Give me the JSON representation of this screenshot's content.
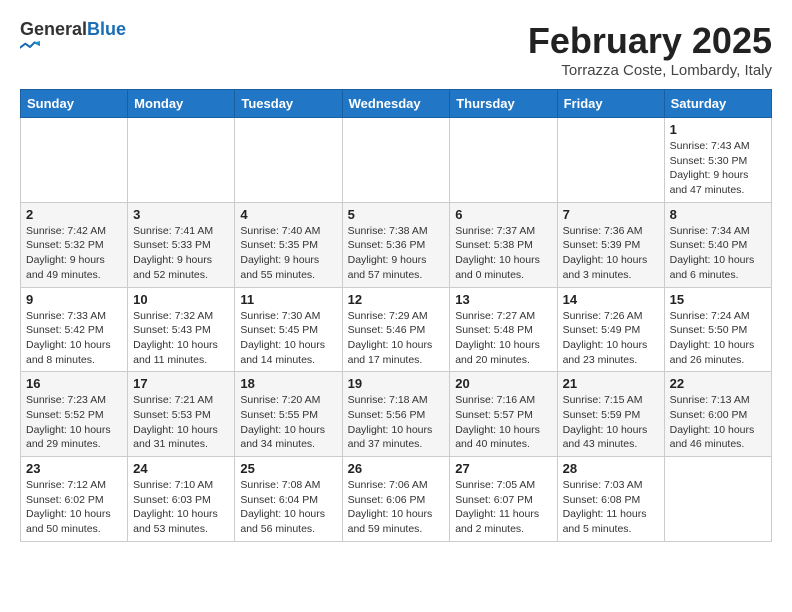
{
  "header": {
    "logo_general": "General",
    "logo_blue": "Blue",
    "month": "February 2025",
    "location": "Torrazza Coste, Lombardy, Italy"
  },
  "days_of_week": [
    "Sunday",
    "Monday",
    "Tuesday",
    "Wednesday",
    "Thursday",
    "Friday",
    "Saturday"
  ],
  "weeks": [
    [
      {
        "day": "",
        "info": ""
      },
      {
        "day": "",
        "info": ""
      },
      {
        "day": "",
        "info": ""
      },
      {
        "day": "",
        "info": ""
      },
      {
        "day": "",
        "info": ""
      },
      {
        "day": "",
        "info": ""
      },
      {
        "day": "1",
        "info": "Sunrise: 7:43 AM\nSunset: 5:30 PM\nDaylight: 9 hours and 47 minutes."
      }
    ],
    [
      {
        "day": "2",
        "info": "Sunrise: 7:42 AM\nSunset: 5:32 PM\nDaylight: 9 hours and 49 minutes."
      },
      {
        "day": "3",
        "info": "Sunrise: 7:41 AM\nSunset: 5:33 PM\nDaylight: 9 hours and 52 minutes."
      },
      {
        "day": "4",
        "info": "Sunrise: 7:40 AM\nSunset: 5:35 PM\nDaylight: 9 hours and 55 minutes."
      },
      {
        "day": "5",
        "info": "Sunrise: 7:38 AM\nSunset: 5:36 PM\nDaylight: 9 hours and 57 minutes."
      },
      {
        "day": "6",
        "info": "Sunrise: 7:37 AM\nSunset: 5:38 PM\nDaylight: 10 hours and 0 minutes."
      },
      {
        "day": "7",
        "info": "Sunrise: 7:36 AM\nSunset: 5:39 PM\nDaylight: 10 hours and 3 minutes."
      },
      {
        "day": "8",
        "info": "Sunrise: 7:34 AM\nSunset: 5:40 PM\nDaylight: 10 hours and 6 minutes."
      }
    ],
    [
      {
        "day": "9",
        "info": "Sunrise: 7:33 AM\nSunset: 5:42 PM\nDaylight: 10 hours and 8 minutes."
      },
      {
        "day": "10",
        "info": "Sunrise: 7:32 AM\nSunset: 5:43 PM\nDaylight: 10 hours and 11 minutes."
      },
      {
        "day": "11",
        "info": "Sunrise: 7:30 AM\nSunset: 5:45 PM\nDaylight: 10 hours and 14 minutes."
      },
      {
        "day": "12",
        "info": "Sunrise: 7:29 AM\nSunset: 5:46 PM\nDaylight: 10 hours and 17 minutes."
      },
      {
        "day": "13",
        "info": "Sunrise: 7:27 AM\nSunset: 5:48 PM\nDaylight: 10 hours and 20 minutes."
      },
      {
        "day": "14",
        "info": "Sunrise: 7:26 AM\nSunset: 5:49 PM\nDaylight: 10 hours and 23 minutes."
      },
      {
        "day": "15",
        "info": "Sunrise: 7:24 AM\nSunset: 5:50 PM\nDaylight: 10 hours and 26 minutes."
      }
    ],
    [
      {
        "day": "16",
        "info": "Sunrise: 7:23 AM\nSunset: 5:52 PM\nDaylight: 10 hours and 29 minutes."
      },
      {
        "day": "17",
        "info": "Sunrise: 7:21 AM\nSunset: 5:53 PM\nDaylight: 10 hours and 31 minutes."
      },
      {
        "day": "18",
        "info": "Sunrise: 7:20 AM\nSunset: 5:55 PM\nDaylight: 10 hours and 34 minutes."
      },
      {
        "day": "19",
        "info": "Sunrise: 7:18 AM\nSunset: 5:56 PM\nDaylight: 10 hours and 37 minutes."
      },
      {
        "day": "20",
        "info": "Sunrise: 7:16 AM\nSunset: 5:57 PM\nDaylight: 10 hours and 40 minutes."
      },
      {
        "day": "21",
        "info": "Sunrise: 7:15 AM\nSunset: 5:59 PM\nDaylight: 10 hours and 43 minutes."
      },
      {
        "day": "22",
        "info": "Sunrise: 7:13 AM\nSunset: 6:00 PM\nDaylight: 10 hours and 46 minutes."
      }
    ],
    [
      {
        "day": "23",
        "info": "Sunrise: 7:12 AM\nSunset: 6:02 PM\nDaylight: 10 hours and 50 minutes."
      },
      {
        "day": "24",
        "info": "Sunrise: 7:10 AM\nSunset: 6:03 PM\nDaylight: 10 hours and 53 minutes."
      },
      {
        "day": "25",
        "info": "Sunrise: 7:08 AM\nSunset: 6:04 PM\nDaylight: 10 hours and 56 minutes."
      },
      {
        "day": "26",
        "info": "Sunrise: 7:06 AM\nSunset: 6:06 PM\nDaylight: 10 hours and 59 minutes."
      },
      {
        "day": "27",
        "info": "Sunrise: 7:05 AM\nSunset: 6:07 PM\nDaylight: 11 hours and 2 minutes."
      },
      {
        "day": "28",
        "info": "Sunrise: 7:03 AM\nSunset: 6:08 PM\nDaylight: 11 hours and 5 minutes."
      },
      {
        "day": "",
        "info": ""
      }
    ]
  ]
}
